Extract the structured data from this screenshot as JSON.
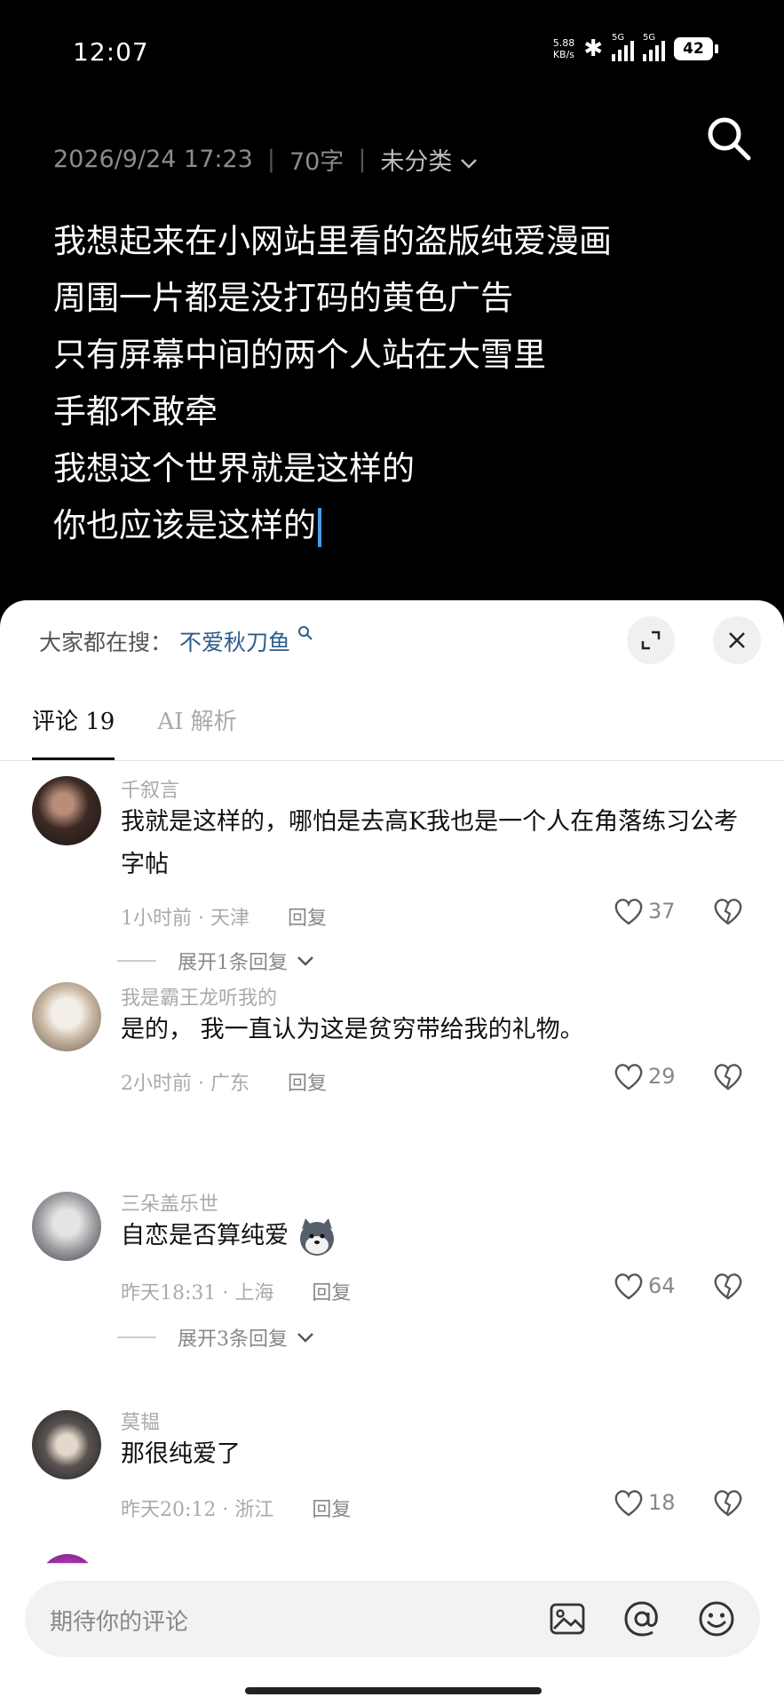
{
  "status": {
    "time": "12:07",
    "net_speed_top": "5.88",
    "net_speed_bottom": "KB/s",
    "sig1_label": "5G",
    "sig2_label": "5G",
    "battery": "42"
  },
  "note": {
    "date": "2026/9/24 17:23",
    "word_count": "70字",
    "category": "未分类",
    "lines": [
      "我想起来在小网站里看的盗版纯爱漫画",
      "周围一片都是没打码的黄色广告",
      "只有屏幕中间的两个人站在大雪里",
      "手都不敢牵",
      "我想这个世界就是这样的",
      "你也应该是这样的"
    ]
  },
  "sheet": {
    "hot_search_label": "大家都在搜：",
    "hot_search_keyword": "不爱秋刀鱼",
    "tabs": [
      {
        "label": "评论 19"
      },
      {
        "label": "AI 解析"
      }
    ],
    "comments": [
      {
        "name": "千叙言",
        "text": "我就是这样的，哪怕是去高K我也是一个人在角落练习公考字帖",
        "time": "1小时前",
        "location": "天津",
        "reply": "回复",
        "likes": "37",
        "expand": "展开1条回复"
      },
      {
        "name": "我是霸王龙听我的",
        "text": "是的， 我一直认为这是贫穷带给我的礼物。",
        "time": "2小时前",
        "location": "广东",
        "reply": "回复",
        "likes": "29"
      },
      {
        "name": "三朵盖乐世",
        "text": "自恋是否算纯爱",
        "time": "昨天18:31",
        "location": "上海",
        "reply": "回复",
        "likes": "64",
        "expand": "展开3条回复"
      },
      {
        "name": "莫韫",
        "text": "那很纯爱了",
        "time": "昨天20:12",
        "location": "浙江",
        "reply": "回复",
        "likes": "18"
      }
    ],
    "input_placeholder": "期待你的评论"
  }
}
